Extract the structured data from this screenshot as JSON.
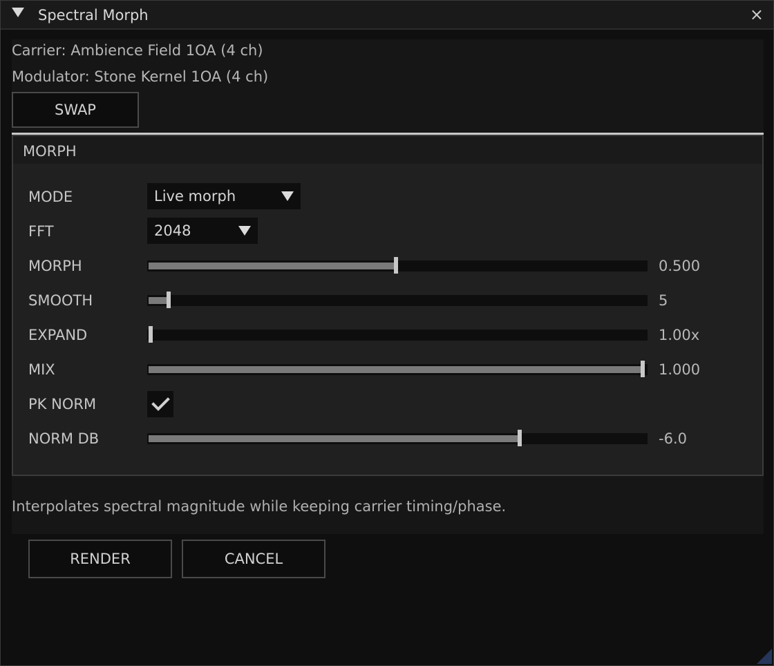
{
  "window": {
    "title": "Spectral Morph",
    "close_glyph": "×"
  },
  "source": {
    "carrier": "Carrier: Ambience Field 1OA (4 ch)",
    "modulator": "Modulator: Stone Kernel 1OA (4 ch)",
    "swap_label": "SWAP"
  },
  "morph": {
    "section_title": "MORPH",
    "mode": {
      "label": "MODE",
      "value": "Live morph"
    },
    "fft": {
      "label": "FFT",
      "value": "2048"
    },
    "sliders": [
      {
        "label": "MORPH",
        "value_text": "0.500",
        "fraction": 0.5
      },
      {
        "label": "SMOOTH",
        "value_text": "5",
        "fraction": 0.04
      },
      {
        "label": "EXPAND",
        "value_text": "1.00x",
        "fraction": 0.0
      },
      {
        "label": "MIX",
        "value_text": "1.000",
        "fraction": 1.0
      },
      {
        "label": "NORM DB",
        "value_text": "-6.0",
        "fraction": 0.75
      }
    ],
    "pk_norm": {
      "label": "PK NORM",
      "checked": true
    }
  },
  "help_text": "Interpolates spectral magnitude while keeping carrier timing/phase.",
  "actions": {
    "render_label": "RENDER",
    "cancel_label": "CANCEL"
  },
  "colors": {
    "accent_resize": "#26365a",
    "slider_fill": "#7a7a7a",
    "slider_grab": "#c8c8c8"
  }
}
